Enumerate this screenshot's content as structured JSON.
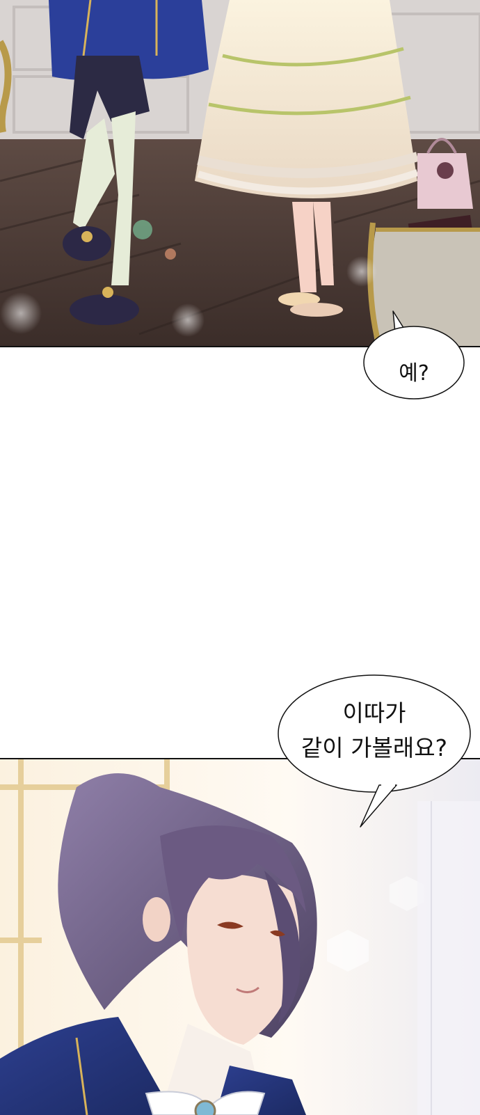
{
  "comic": {
    "panels": [
      {
        "name": "top-panel",
        "description_icon": "legs-in-room"
      },
      {
        "name": "bottom-panel",
        "description_icon": "purple-haired-man"
      }
    ],
    "bubbles": [
      {
        "lines": [
          "예?"
        ]
      },
      {
        "lines": [
          "이따가",
          "같이 가볼래요?"
        ]
      }
    ]
  },
  "colors": {
    "floor": "#4a3a35",
    "wall": "#e6e2df",
    "coat": "#2b3f9a",
    "dress": "#f5ecd8",
    "hair": "#6b5a82",
    "skin": "#f6ddd2",
    "bubble_border": "#111111"
  }
}
